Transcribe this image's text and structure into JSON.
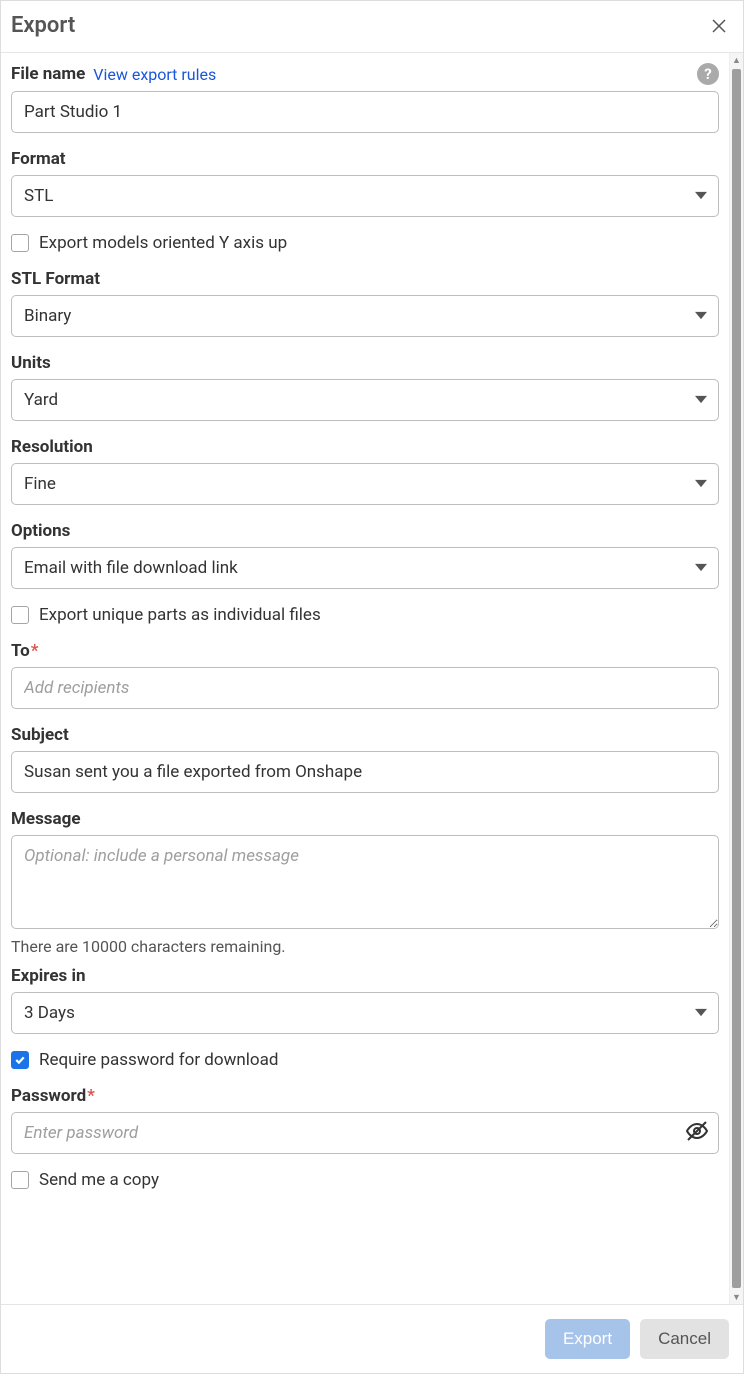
{
  "header": {
    "title": "Export"
  },
  "fields": {
    "file_name": {
      "label": "File name",
      "link": "View export rules",
      "value": "Part Studio 1"
    },
    "format": {
      "label": "Format",
      "value": "STL"
    },
    "y_up": {
      "label": "Export models oriented Y axis up",
      "checked": false
    },
    "stl_format": {
      "label": "STL Format",
      "value": "Binary"
    },
    "units": {
      "label": "Units",
      "value": "Yard"
    },
    "resolution": {
      "label": "Resolution",
      "value": "Fine"
    },
    "options": {
      "label": "Options",
      "value": "Email with file download link"
    },
    "unique_parts": {
      "label": "Export unique parts as individual files",
      "checked": false
    },
    "to": {
      "label": "To",
      "placeholder": "Add recipients",
      "required": true
    },
    "subject": {
      "label": "Subject",
      "value": "Susan sent you a file exported from Onshape"
    },
    "message": {
      "label": "Message",
      "placeholder": "Optional: include a personal message",
      "note": "There are 10000 characters remaining."
    },
    "expires": {
      "label": "Expires in",
      "value": "3 Days"
    },
    "require_pw": {
      "label": "Require password for download",
      "checked": true
    },
    "password": {
      "label": "Password",
      "placeholder": "Enter password",
      "required": true
    },
    "send_copy": {
      "label": "Send me a copy",
      "checked": false
    }
  },
  "footer": {
    "export": "Export",
    "cancel": "Cancel"
  }
}
